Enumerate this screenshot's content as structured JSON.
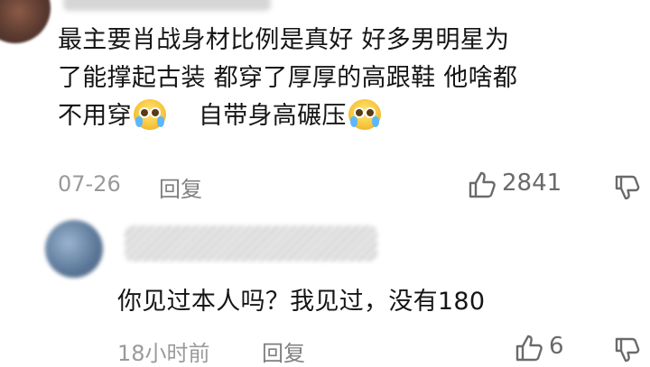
{
  "comment1": {
    "username": "",
    "text_line1": "最主要肖战身材比例是真好  好多男明星为",
    "text_line2": "了能撑起古装 都穿了厚厚的高跟鞋   他啥都",
    "text_line3a": "不用穿",
    "text_line3b": "自带身高碾压",
    "date": "07-26",
    "reply_label": "回复",
    "like_count": "2841",
    "emoji_icon": "crying-laughing-emoji-icon"
  },
  "comment2": {
    "username": "",
    "text": "你见过本人吗？我见过，没有180",
    "time": "18小时前",
    "reply_label": "回复",
    "like_count": "6"
  },
  "colors": {
    "text": "#151515",
    "meta": "#9a9a9a",
    "icon": "#6a6a6a"
  }
}
